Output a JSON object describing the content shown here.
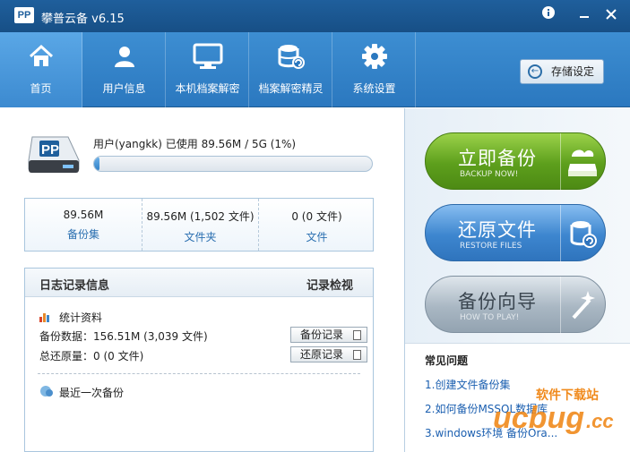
{
  "window": {
    "title": "攀普云备 v6.15",
    "logo_text": "PP"
  },
  "toolbar": {
    "items": [
      {
        "label": "首页",
        "icon": "home-icon"
      },
      {
        "label": "用户信息",
        "icon": "user-icon"
      },
      {
        "label": "本机档案解密",
        "icon": "monitor-icon"
      },
      {
        "label": "档案解密精灵",
        "icon": "database-icon"
      },
      {
        "label": "系统设置",
        "icon": "gear-icon"
      }
    ],
    "storage_settings_label": "存储设定"
  },
  "account": {
    "user_line": "用户(yangkk) 已使用  89.56M / 5G (1%)",
    "usage_fraction": 0.02
  },
  "stats": [
    {
      "value": "89.56M",
      "label": "备份集"
    },
    {
      "value": "89.56M  (1,502 文件)",
      "label": "文件夹"
    },
    {
      "value": "0  (0 文件)",
      "label": "文件"
    }
  ],
  "log": {
    "title": "日志记录信息",
    "view_label": "记录检视",
    "stats_heading": "统计资料",
    "backup_data": "备份数据：156.51M  (3,039 文件)",
    "restore_total": "总还原量：0  (0 文件)",
    "backup_record_btn": "备份记录",
    "restore_record_btn": "还原记录",
    "last_backup": "最近一次备份"
  },
  "actions": [
    {
      "title": "立即备份",
      "subtitle": "BACKUP NOW!"
    },
    {
      "title": "还原文件",
      "subtitle": "RESTORE FILES"
    },
    {
      "title": "备份向导",
      "subtitle": "HOW TO PLAY!"
    }
  ],
  "faq": {
    "title": "常见问题",
    "items": [
      "1.创建文件备份集",
      "2.如何备份MSSQL数据库",
      "3.windows环境 备份Ora..."
    ]
  },
  "watermark": {
    "text_top": "软件下载站",
    "text_main": "ucbug",
    "text_cc": ".cc"
  },
  "colors": {
    "title_bar": "#1f5f9c",
    "toolbar": "#2b78bf",
    "backup_green": "#5d9f1c",
    "restore_blue": "#3d86cf",
    "wizard_gray": "#a9b7c3",
    "link_blue": "#1b5fb0"
  }
}
